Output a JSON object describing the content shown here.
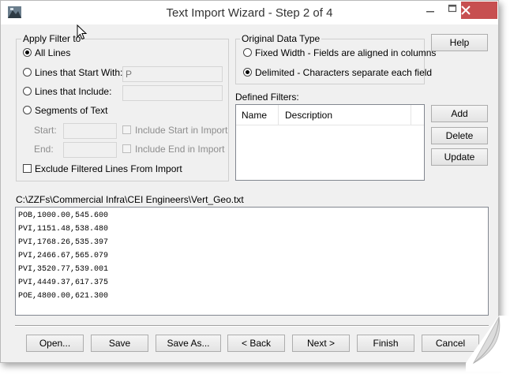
{
  "window": {
    "title": "Text Import Wizard - Step 2 of 4",
    "minimize_icon": "minimize-icon",
    "maximize_icon": "maximize-icon",
    "close_icon": "close-icon"
  },
  "filter": {
    "legend": "Apply Filter to",
    "options": [
      {
        "label": "All Lines",
        "selected": true
      },
      {
        "label": "Lines that Start With:",
        "selected": false,
        "value": "P"
      },
      {
        "label": "Lines that Include:",
        "selected": false,
        "value": ""
      },
      {
        "label": "Segments of Text",
        "selected": false
      }
    ],
    "start_label": "Start:",
    "end_label": "End:",
    "include_start_label": "Include Start in Import",
    "include_end_label": "Include End in Import",
    "exclude_label": "Exclude Filtered Lines From Import"
  },
  "data_type": {
    "legend": "Original Data Type",
    "fixed_label": "Fixed Width - Fields are aligned in columns",
    "delimited_label": "Delimited - Characters separate each field",
    "selected": "delimited"
  },
  "defined_filters": {
    "label": "Defined Filters:",
    "columns": [
      "Name",
      "Description"
    ]
  },
  "side_buttons": {
    "help": "Help",
    "add": "Add",
    "delete": "Delete",
    "update": "Update"
  },
  "file_path": "C:\\ZZFs\\Commercial Infra\\CEI Engineers\\Vert_Geo.txt",
  "preview_lines": [
    "POB,1000.00,545.600",
    "PVI,1151.48,538.480",
    "PVI,1768.26,535.397",
    "PVI,2466.67,565.079",
    "PVI,3520.77,539.001",
    "PVI,4449.37,617.375",
    "POE,4800.00,621.300"
  ],
  "bottom_buttons": {
    "open": "Open...",
    "save": "Save",
    "save_as": "Save As...",
    "back": "< Back",
    "next": "Next >",
    "finish": "Finish",
    "cancel": "Cancel"
  }
}
